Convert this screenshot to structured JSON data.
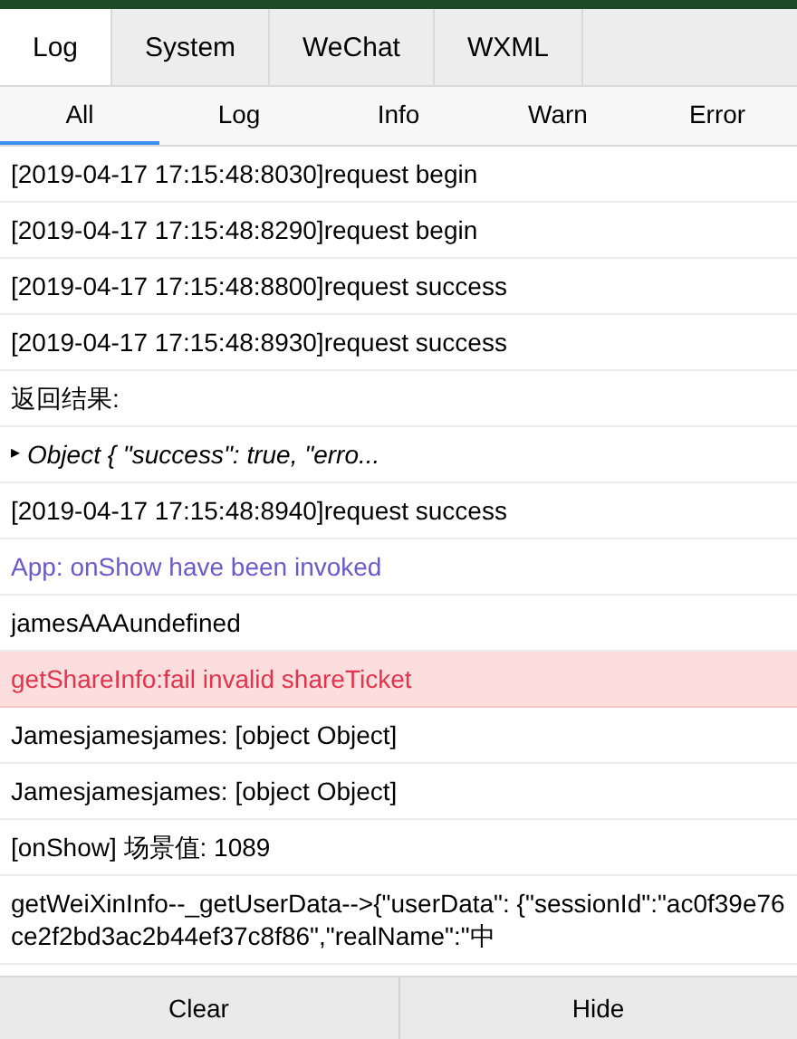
{
  "tabs": [
    {
      "label": "Log",
      "selected": true
    },
    {
      "label": "System",
      "selected": false
    },
    {
      "label": "WeChat",
      "selected": false
    },
    {
      "label": "WXML",
      "selected": false
    }
  ],
  "filters": [
    {
      "label": "All",
      "selected": true
    },
    {
      "label": "Log",
      "selected": false
    },
    {
      "label": "Info",
      "selected": false
    },
    {
      "label": "Warn",
      "selected": false
    },
    {
      "label": "Error",
      "selected": false
    }
  ],
  "logs": [
    {
      "kind": "log",
      "text": "[2019-04-17 17:15:48:8030]request begin"
    },
    {
      "kind": "log",
      "text": "[2019-04-17 17:15:48:8290]request begin"
    },
    {
      "kind": "log",
      "text": "[2019-04-17 17:15:48:8800]request success"
    },
    {
      "kind": "log",
      "text": "[2019-04-17 17:15:48:8930]request success"
    },
    {
      "kind": "log",
      "text": "返回结果:"
    },
    {
      "kind": "object",
      "toggle": "▸",
      "text": "Object { \"success\": true, \"erro..."
    },
    {
      "kind": "log",
      "text": "[2019-04-17 17:15:48:8940]request success"
    },
    {
      "kind": "info",
      "text": "App: onShow have been invoked"
    },
    {
      "kind": "log",
      "text": "jamesAAAundefined"
    },
    {
      "kind": "error",
      "text": "getShareInfo:fail invalid shareTicket"
    },
    {
      "kind": "log",
      "text": "Jamesjamesjames: [object Object]"
    },
    {
      "kind": "log",
      "text": "Jamesjamesjames: [object Object]"
    },
    {
      "kind": "log",
      "text": "[onShow] 场景值: 1089"
    },
    {
      "kind": "log",
      "text": "getWeiXinInfo--_getUserData-->{\"userData\": {\"sessionId\":\"ac0f39e76ce2f2bd3ac2b44ef37c8f86\",\"realName\":\"中"
    }
  ],
  "buttons": [
    "Clear",
    "Hide"
  ]
}
